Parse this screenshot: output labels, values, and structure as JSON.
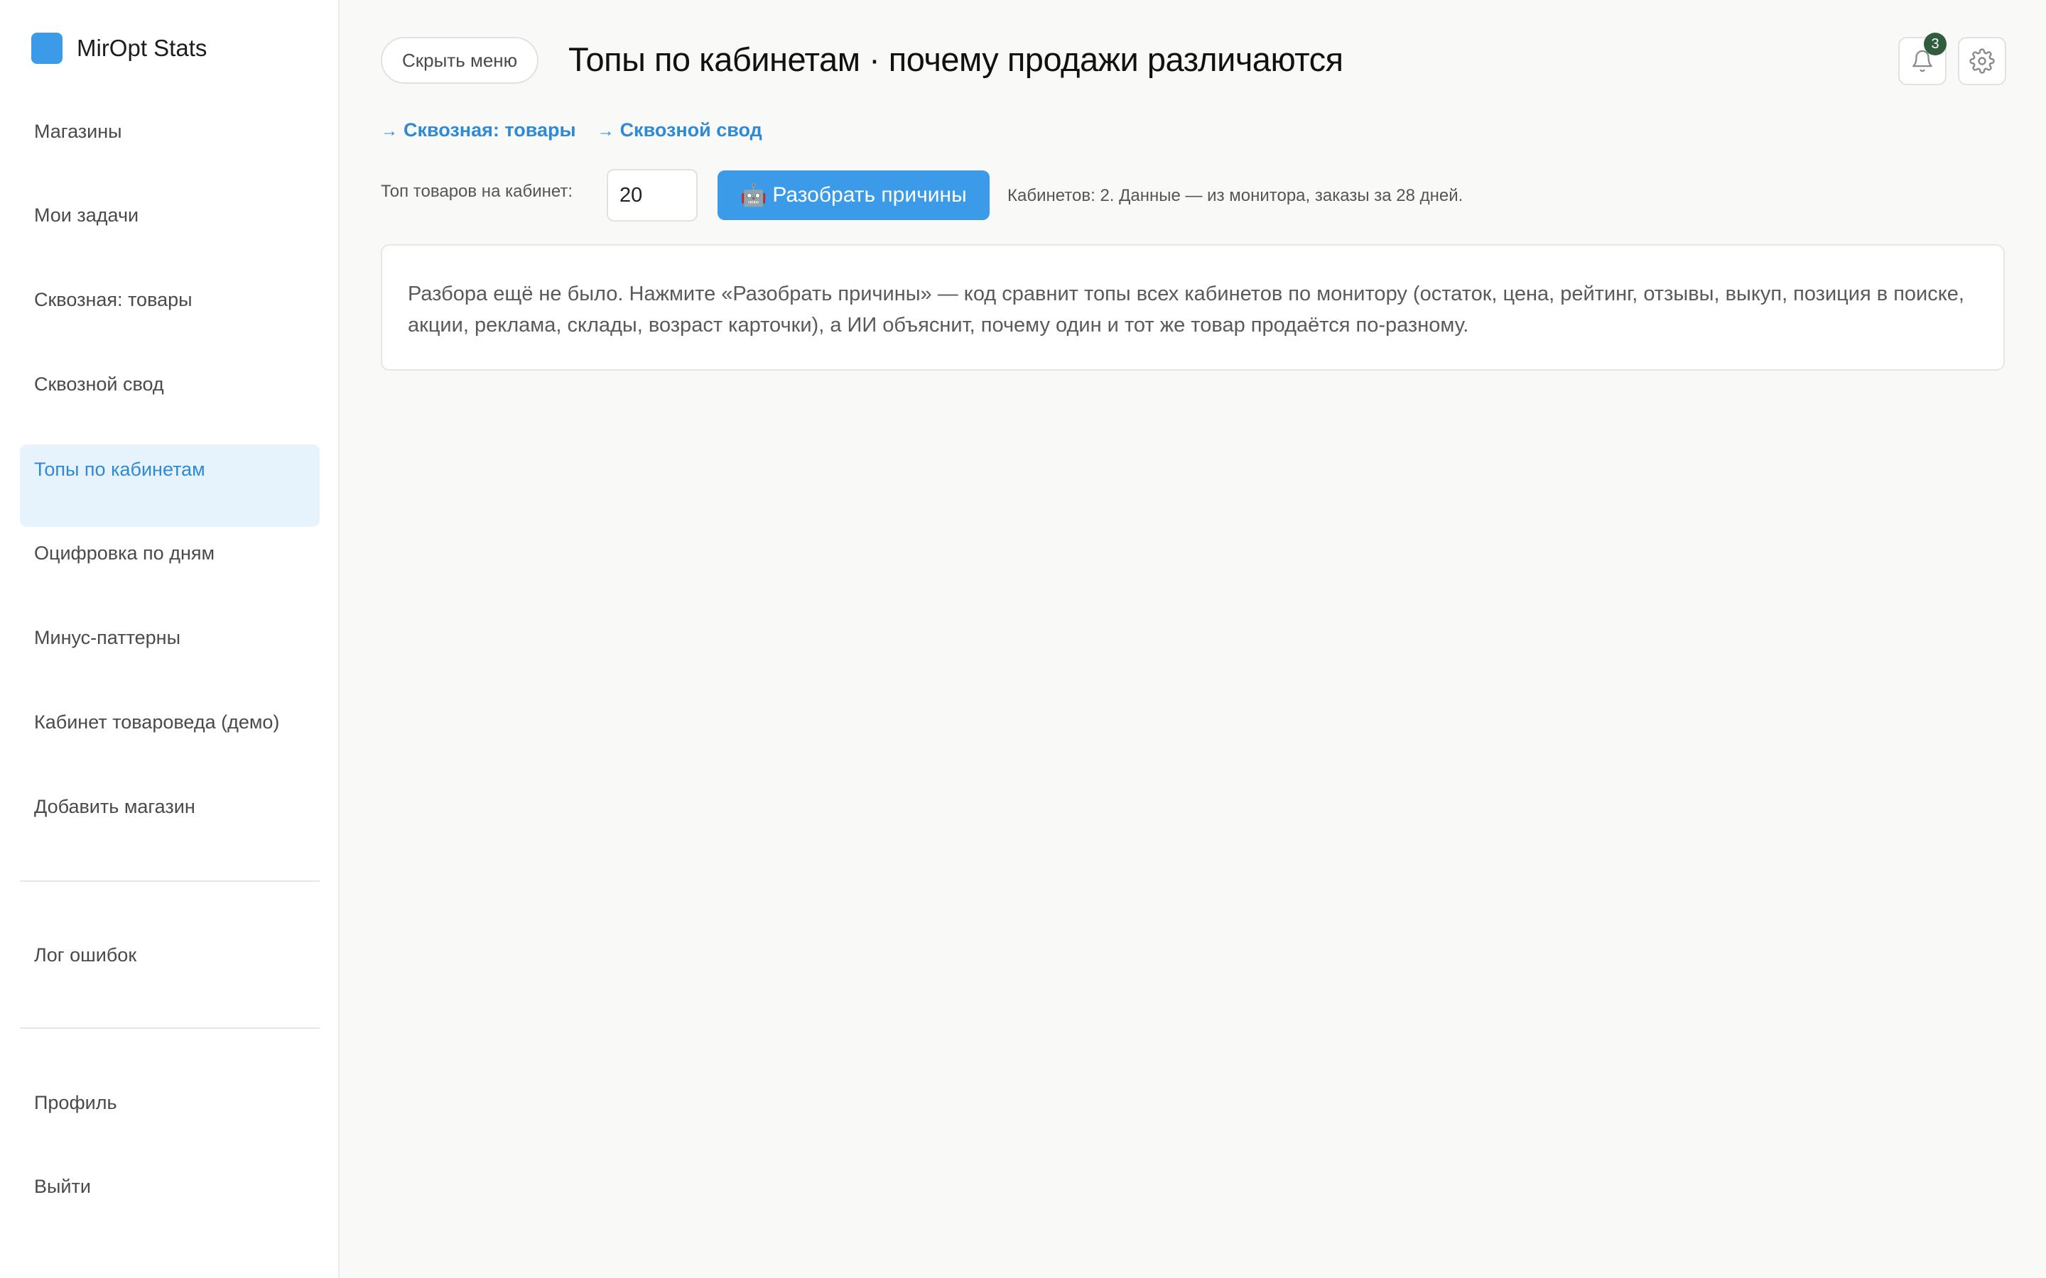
{
  "app": {
    "title": "MirOpt Stats",
    "accent": "#3b9be8"
  },
  "sidebar": {
    "items": [
      {
        "label": "Магазины"
      },
      {
        "label": "Мои задачи"
      },
      {
        "label": "Сквозная: товары"
      },
      {
        "label": "Сквозной свод"
      },
      {
        "label": "Топы по кабинетам",
        "active": true
      },
      {
        "label": "Оцифровка по дням"
      },
      {
        "label": "Минус-паттерны"
      },
      {
        "label": "Кабинет товароведа (демо)"
      },
      {
        "label": "Добавить магазин"
      },
      {
        "label": "Лог ошибок"
      },
      {
        "label": "Профиль"
      },
      {
        "label": "Выйти"
      }
    ]
  },
  "header": {
    "hide_menu_label": "Скрыть меню",
    "title": "Топы по кабинетам · почему продажи различаются",
    "notifications_count": "3"
  },
  "links": [
    {
      "arrow": "→",
      "label": "Сквозная: товары"
    },
    {
      "arrow": "→",
      "label": "Сквозной свод"
    }
  ],
  "controls": {
    "top_label": "Топ товаров на кабинет:",
    "top_value": "20",
    "analyze_icon": "🤖",
    "analyze_label": "Разобрать причины",
    "info": "Кабинетов: 2. Данные — из монитора, заказы за 28 дней."
  },
  "notice": {
    "text": "Разбора ещё не было. Нажмите «Разобрать причины» — код сравнит топы всех кабинетов по монитору (остаток, цена, рейтинг, отзывы, выкуп, позиция в поиске, акции, реклама, склады, возраст карточки), а ИИ объяснит, почему один и тот же товар продаётся по-разному."
  }
}
